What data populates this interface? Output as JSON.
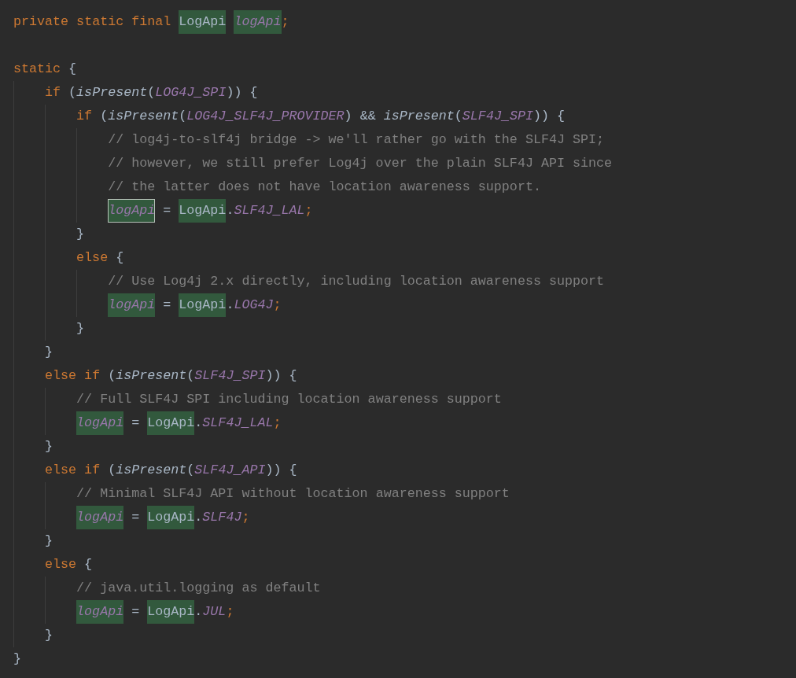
{
  "editor": {
    "lines": [
      {
        "tokens": [
          {
            "text": "private static final ",
            "kind": "keyword",
            "highlighted": false,
            "outlined": false
          },
          {
            "text": "LogApi",
            "kind": "text",
            "highlighted": true,
            "outlined": false
          },
          {
            "text": " logApi",
            "kind": "field",
            "highlighted": true,
            "outlined": false
          },
          {
            "text": ";",
            "kind": "semicolon",
            "highlighted": false,
            "outlined": false
          }
        ]
      },
      {
        "blank": true
      },
      {
        "tokens": [
          {
            "text": "static",
            "kind": "keyword",
            "highlighted": false,
            "outlined": false
          },
          {
            "text": " {",
            "kind": "text",
            "highlighted": false,
            "outlined": false
          }
        ],
        "children": [
          {
            "tokens": [
              {
                "text": "if",
                "kind": "keyword",
                "highlighted": false,
                "outlined": false
              },
              {
                "text": " (",
                "kind": "text",
                "highlighted": false,
                "outlined": false
              },
              {
                "text": "isPresent",
                "kind": "method",
                "highlighted": false,
                "outlined": false
              },
              {
                "text": "(",
                "kind": "text",
                "highlighted": false,
                "outlined": false
              },
              {
                "text": "LOG4J_SPI",
                "kind": "constant",
                "highlighted": false,
                "outlined": false
              },
              {
                "text": ")) {",
                "kind": "text",
                "highlighted": false,
                "outlined": false
              }
            ],
            "children": [
              {
                "tokens": [
                  {
                    "text": "if",
                    "kind": "keyword",
                    "highlighted": false,
                    "outlined": false
                  },
                  {
                    "text": " (",
                    "kind": "text",
                    "highlighted": false,
                    "outlined": false
                  },
                  {
                    "text": "isPresent",
                    "kind": "method",
                    "highlighted": false,
                    "outlined": false
                  },
                  {
                    "text": "(",
                    "kind": "text",
                    "highlighted": false,
                    "outlined": false
                  },
                  {
                    "text": "LOG4J_SLF4J_PROVIDER",
                    "kind": "constant",
                    "highlighted": false,
                    "outlined": false
                  },
                  {
                    "text": ") && ",
                    "kind": "text",
                    "highlighted": false,
                    "outlined": false
                  },
                  {
                    "text": "isPresent",
                    "kind": "method",
                    "highlighted": false,
                    "outlined": false
                  },
                  {
                    "text": "(",
                    "kind": "text",
                    "highlighted": false,
                    "outlined": false
                  },
                  {
                    "text": "SLF4J_SPI",
                    "kind": "constant",
                    "highlighted": false,
                    "outlined": false
                  },
                  {
                    "text": ")) {",
                    "kind": "text",
                    "highlighted": false,
                    "outlined": false
                  }
                ],
                "children": [
                  {
                    "tokens": [
                      {
                        "text": "// log4j-to-slf4j bridge -> we'll rather go with the SLF4J SPI;",
                        "kind": "comment",
                        "highlighted": false,
                        "outlined": false
                      }
                    ]
                  },
                  {
                    "tokens": [
                      {
                        "text": "// however, we still prefer Log4j over the plain SLF4J API since",
                        "kind": "comment",
                        "highlighted": false,
                        "outlined": false
                      }
                    ]
                  },
                  {
                    "tokens": [
                      {
                        "text": "// the latter does not have location awareness support.",
                        "kind": "comment",
                        "highlighted": false,
                        "outlined": false
                      }
                    ]
                  },
                  {
                    "tokens": [
                      {
                        "text": "logApi",
                        "kind": "field",
                        "highlighted": true,
                        "outlined": true
                      },
                      {
                        "text": " = ",
                        "kind": "text",
                        "highlighted": false,
                        "outlined": false
                      },
                      {
                        "text": "LogApi",
                        "kind": "text",
                        "highlighted": true,
                        "outlined": false
                      },
                      {
                        "text": ".",
                        "kind": "text",
                        "highlighted": false,
                        "outlined": false
                      },
                      {
                        "text": "SLF4J_LAL",
                        "kind": "constant",
                        "highlighted": false,
                        "outlined": false
                      },
                      {
                        "text": ";",
                        "kind": "semicolon",
                        "highlighted": false,
                        "outlined": false
                      }
                    ]
                  }
                ]
              },
              {
                "tokens": [
                  {
                    "text": "}",
                    "kind": "text",
                    "highlighted": false,
                    "outlined": false
                  }
                ]
              },
              {
                "tokens": [
                  {
                    "text": "else",
                    "kind": "keyword",
                    "highlighted": false,
                    "outlined": false
                  },
                  {
                    "text": " {",
                    "kind": "text",
                    "highlighted": false,
                    "outlined": false
                  }
                ],
                "children": [
                  {
                    "tokens": [
                      {
                        "text": "// Use Log4j 2.x directly, including location awareness support",
                        "kind": "comment",
                        "highlighted": false,
                        "outlined": false
                      }
                    ]
                  },
                  {
                    "tokens": [
                      {
                        "text": "logApi",
                        "kind": "field",
                        "highlighted": true,
                        "outlined": false
                      },
                      {
                        "text": " = ",
                        "kind": "text",
                        "highlighted": false,
                        "outlined": false
                      },
                      {
                        "text": "LogApi",
                        "kind": "text",
                        "highlighted": true,
                        "outlined": false
                      },
                      {
                        "text": ".",
                        "kind": "text",
                        "highlighted": false,
                        "outlined": false
                      },
                      {
                        "text": "LOG4J",
                        "kind": "constant",
                        "highlighted": false,
                        "outlined": false
                      },
                      {
                        "text": ";",
                        "kind": "semicolon",
                        "highlighted": false,
                        "outlined": false
                      }
                    ]
                  }
                ]
              },
              {
                "tokens": [
                  {
                    "text": "}",
                    "kind": "text",
                    "highlighted": false,
                    "outlined": false
                  }
                ]
              }
            ]
          },
          {
            "tokens": [
              {
                "text": "}",
                "kind": "text",
                "highlighted": false,
                "outlined": false
              }
            ]
          },
          {
            "tokens": [
              {
                "text": "else if",
                "kind": "keyword",
                "highlighted": false,
                "outlined": false
              },
              {
                "text": " (",
                "kind": "text",
                "highlighted": false,
                "outlined": false
              },
              {
                "text": "isPresent",
                "kind": "method",
                "highlighted": false,
                "outlined": false
              },
              {
                "text": "(",
                "kind": "text",
                "highlighted": false,
                "outlined": false
              },
              {
                "text": "SLF4J_SPI",
                "kind": "constant",
                "highlighted": false,
                "outlined": false
              },
              {
                "text": ")) {",
                "kind": "text",
                "highlighted": false,
                "outlined": false
              }
            ],
            "children": [
              {
                "tokens": [
                  {
                    "text": "// Full SLF4J SPI including location awareness support",
                    "kind": "comment",
                    "highlighted": false,
                    "outlined": false
                  }
                ]
              },
              {
                "tokens": [
                  {
                    "text": "logApi",
                    "kind": "field",
                    "highlighted": true,
                    "outlined": false
                  },
                  {
                    "text": " = ",
                    "kind": "text",
                    "highlighted": false,
                    "outlined": false
                  },
                  {
                    "text": "LogApi",
                    "kind": "text",
                    "highlighted": true,
                    "outlined": false
                  },
                  {
                    "text": ".",
                    "kind": "text",
                    "highlighted": false,
                    "outlined": false
                  },
                  {
                    "text": "SLF4J_LAL",
                    "kind": "constant",
                    "highlighted": false,
                    "outlined": false
                  },
                  {
                    "text": ";",
                    "kind": "semicolon",
                    "highlighted": false,
                    "outlined": false
                  }
                ]
              }
            ]
          },
          {
            "tokens": [
              {
                "text": "}",
                "kind": "text",
                "highlighted": false,
                "outlined": false
              }
            ]
          },
          {
            "tokens": [
              {
                "text": "else if",
                "kind": "keyword",
                "highlighted": false,
                "outlined": false
              },
              {
                "text": " (",
                "kind": "text",
                "highlighted": false,
                "outlined": false
              },
              {
                "text": "isPresent",
                "kind": "method",
                "highlighted": false,
                "outlined": false
              },
              {
                "text": "(",
                "kind": "text",
                "highlighted": false,
                "outlined": false
              },
              {
                "text": "SLF4J_API",
                "kind": "constant",
                "highlighted": false,
                "outlined": false
              },
              {
                "text": ")) {",
                "kind": "text",
                "highlighted": false,
                "outlined": false
              }
            ],
            "children": [
              {
                "tokens": [
                  {
                    "text": "// Minimal SLF4J API without location awareness support",
                    "kind": "comment",
                    "highlighted": false,
                    "outlined": false
                  }
                ]
              },
              {
                "tokens": [
                  {
                    "text": "logApi",
                    "kind": "field",
                    "highlighted": true,
                    "outlined": false
                  },
                  {
                    "text": " = ",
                    "kind": "text",
                    "highlighted": false,
                    "outlined": false
                  },
                  {
                    "text": "LogApi",
                    "kind": "text",
                    "highlighted": true,
                    "outlined": false
                  },
                  {
                    "text": ".",
                    "kind": "text",
                    "highlighted": false,
                    "outlined": false
                  },
                  {
                    "text": "SLF4J",
                    "kind": "constant",
                    "highlighted": false,
                    "outlined": false
                  },
                  {
                    "text": ";",
                    "kind": "semicolon",
                    "highlighted": false,
                    "outlined": false
                  }
                ]
              }
            ]
          },
          {
            "tokens": [
              {
                "text": "}",
                "kind": "text",
                "highlighted": false,
                "outlined": false
              }
            ]
          },
          {
            "tokens": [
              {
                "text": "else",
                "kind": "keyword",
                "highlighted": false,
                "outlined": false
              },
              {
                "text": " {",
                "kind": "text",
                "highlighted": false,
                "outlined": false
              }
            ],
            "children": [
              {
                "tokens": [
                  {
                    "text": "// java.util.logging as default",
                    "kind": "comment",
                    "highlighted": false,
                    "outlined": false
                  }
                ]
              },
              {
                "tokens": [
                  {
                    "text": "logApi",
                    "kind": "field",
                    "highlighted": true,
                    "outlined": false
                  },
                  {
                    "text": " = ",
                    "kind": "text",
                    "highlighted": false,
                    "outlined": false
                  },
                  {
                    "text": "LogApi",
                    "kind": "text",
                    "highlighted": true,
                    "outlined": false
                  },
                  {
                    "text": ".",
                    "kind": "text",
                    "highlighted": false,
                    "outlined": false
                  },
                  {
                    "text": "JUL",
                    "kind": "constant",
                    "highlighted": false,
                    "outlined": false
                  },
                  {
                    "text": ";",
                    "kind": "semicolon",
                    "highlighted": false,
                    "outlined": false
                  }
                ]
              }
            ]
          },
          {
            "tokens": [
              {
                "text": "}",
                "kind": "text",
                "highlighted": false,
                "outlined": false
              }
            ]
          }
        ]
      },
      {
        "tokens": [
          {
            "text": "}",
            "kind": "text",
            "highlighted": false,
            "outlined": false
          }
        ]
      }
    ]
  }
}
